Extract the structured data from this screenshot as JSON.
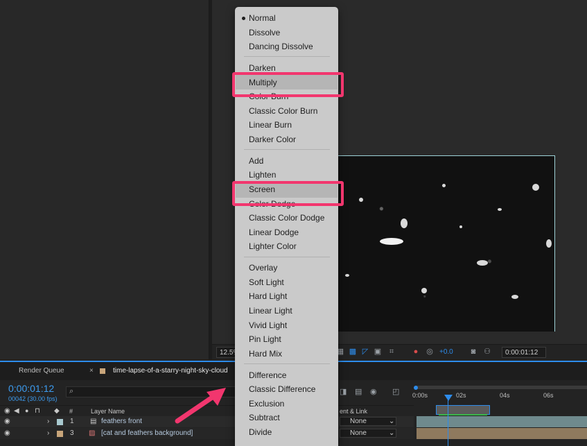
{
  "viewer": {
    "zoom": "12.5%",
    "exposure": "+0.0",
    "timecode": "0:00:01:12"
  },
  "timeline": {
    "render_queue_tab": "Render Queue",
    "close_glyph": "×",
    "comp_tab": "time-lapse-of-a-starry-night-sky-cloud",
    "current_time": "0:00:01:12",
    "frame_info": "00042 (30.00 fps)",
    "search_icon": "⌕",
    "col_number": "#",
    "col_layer_name": "Layer Name",
    "col_parent": "ent & Link",
    "ruler": [
      "0:00s",
      "02s",
      "04s",
      "06s"
    ],
    "layers": [
      {
        "num": "1",
        "name": "feathers front",
        "parent": "None",
        "color": "#a8c9cf"
      },
      {
        "num": "3",
        "name": "[cat and feathers background]",
        "parent": "None",
        "color": "#c8a57a"
      }
    ]
  },
  "menu": {
    "selected": "Normal",
    "groups": [
      [
        "Normal",
        "Dissolve",
        "Dancing Dissolve"
      ],
      [
        "Darken",
        "Multiply",
        "Color Burn",
        "Classic Color Burn",
        "Linear Burn",
        "Darker Color"
      ],
      [
        "Add",
        "Lighten",
        "Screen",
        "Color Dodge",
        "Classic Color Dodge",
        "Linear Dodge",
        "Lighter Color"
      ],
      [
        "Overlay",
        "Soft Light",
        "Hard Light",
        "Linear Light",
        "Vivid Light",
        "Pin Light",
        "Hard Mix"
      ],
      [
        "Difference",
        "Classic Difference",
        "Exclusion",
        "Subtract",
        "Divide"
      ]
    ],
    "highlighted": [
      "Multiply",
      "Screen"
    ]
  },
  "colors": {
    "highlight": "#f2366e",
    "accent": "#2d8ceb",
    "menu_bg": "#cacaca"
  }
}
